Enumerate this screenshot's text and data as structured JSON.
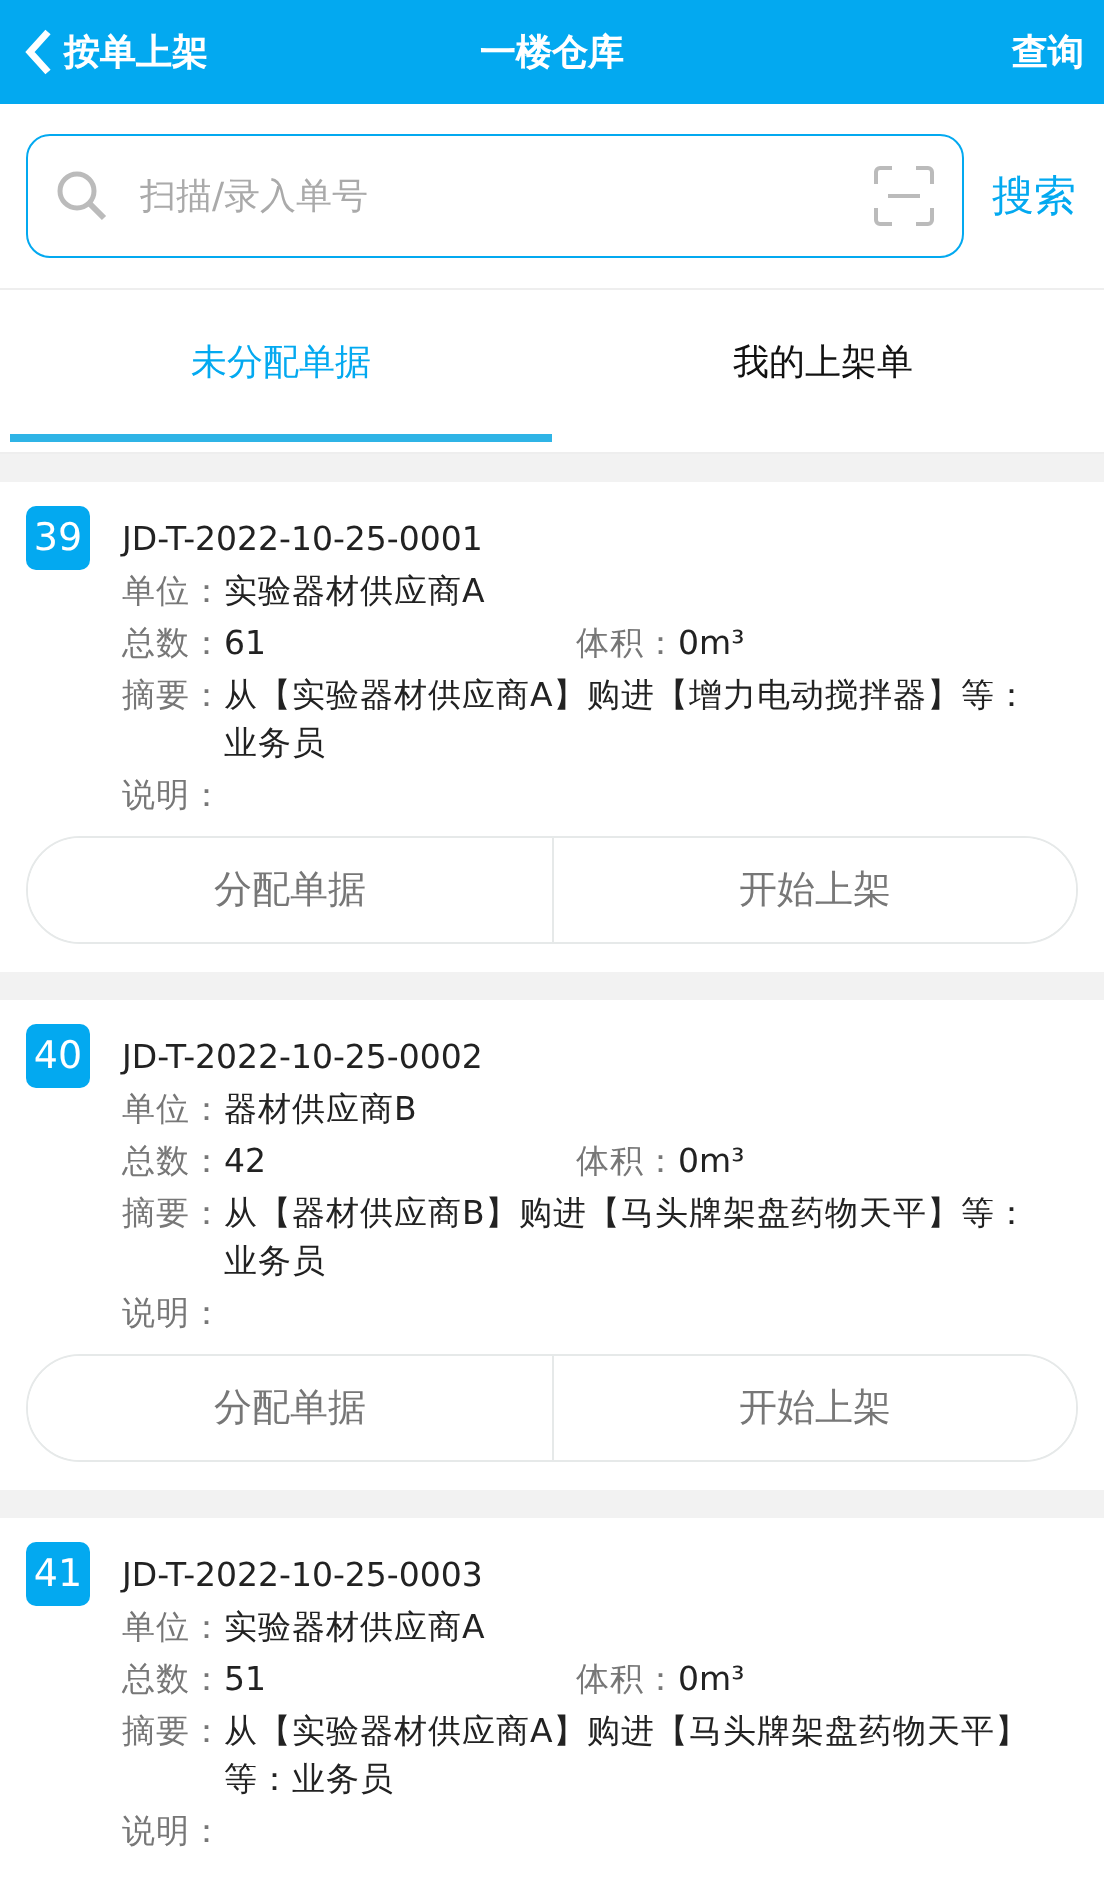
{
  "header": {
    "back_label": "按单上架",
    "title": "一楼仓库",
    "action": "查询"
  },
  "search": {
    "placeholder": "扫描/录入单号",
    "button": "搜索"
  },
  "tabs": [
    {
      "label": "未分配单据",
      "selected": true
    },
    {
      "label": "我的上架单",
      "selected": false
    }
  ],
  "cards": [
    {
      "index": "39",
      "number": "JD-T-2022-10-25-0001",
      "unit_label": "单位：",
      "unit": "实验器材供应商A",
      "total_label": "总数：",
      "total": "61",
      "volume_label": "体积：",
      "volume": "0m³",
      "summary_label": "摘要：",
      "summary": "从【实验器材供应商A】购进【增力电动搅拌器】等：业务员",
      "note_label": "说明：",
      "buttons": [
        "分配单据",
        "开始上架"
      ]
    },
    {
      "index": "40",
      "number": "JD-T-2022-10-25-0002",
      "unit_label": "单位：",
      "unit": "器材供应商B",
      "total_label": "总数：",
      "total": "42",
      "volume_label": "体积：",
      "volume": "0m³",
      "summary_label": "摘要：",
      "summary": "从【器材供应商B】购进【马头牌架盘药物天平】等：业务员",
      "note_label": "说明：",
      "buttons": [
        "分配单据",
        "开始上架"
      ]
    },
    {
      "index": "41",
      "number": "JD-T-2022-10-25-0003",
      "unit_label": "单位：",
      "unit": "实验器材供应商A",
      "total_label": "总数：",
      "total": "51",
      "volume_label": "体积：",
      "volume": "0m³",
      "summary_label": "摘要：",
      "summary": "从【实验器材供应商A】购进【马头牌架盘药物天平】等：业务员",
      "note_label": "说明："
    }
  ]
}
